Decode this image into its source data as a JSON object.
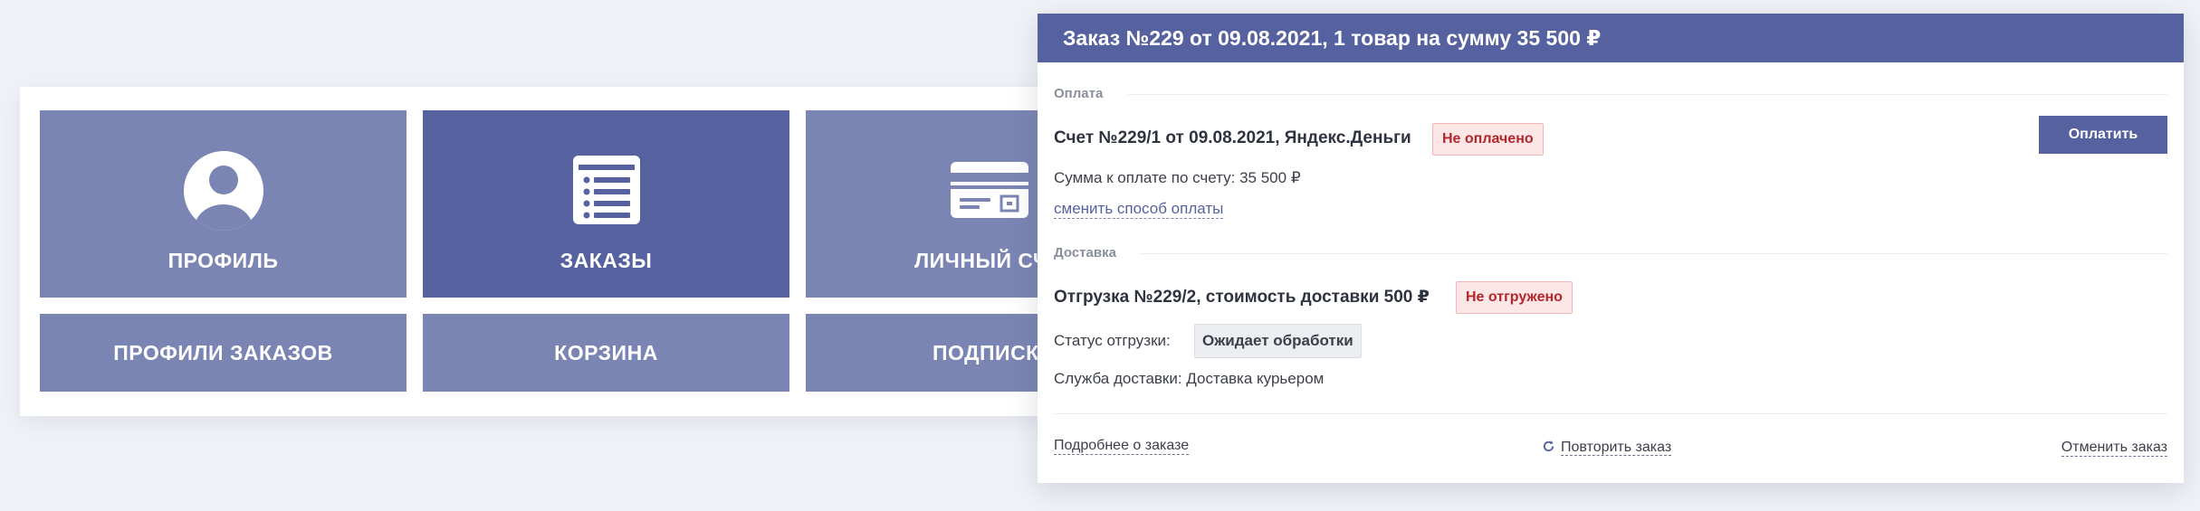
{
  "tiles": {
    "profile": {
      "label": "ПРОФИЛЬ",
      "icon": "user-icon"
    },
    "orders": {
      "label": "ЗАКАЗЫ",
      "icon": "list-icon"
    },
    "account": {
      "label": "ЛИЧНЫЙ СЧЕТ",
      "icon": "card-icon"
    },
    "order_profiles": {
      "label": "ПРОФИЛИ ЗАКАЗОВ"
    },
    "cart": {
      "label": "КОРЗИНА"
    },
    "subscriptions": {
      "label": "ПОДПИСКИ"
    }
  },
  "order": {
    "header": "Заказ №229 от 09.08.2021, 1 товар на сумму 35 500 ₽",
    "payment": {
      "section_title": "Оплата",
      "invoice": "Счет №229/1 от 09.08.2021, Яндекс.Деньги",
      "status": "Не оплачено",
      "pay_button": "Оплатить",
      "amount": "Сумма к оплате по счету: 35 500 ₽",
      "change_method": "сменить способ оплаты"
    },
    "delivery": {
      "section_title": "Доставка",
      "shipment": "Отгрузка №229/2, стоимость доставки 500 ₽",
      "status": "Не отгружено",
      "shipment_status_label": "Статус отгрузки:",
      "shipment_status_value": "Ожидает обработки",
      "service": "Служба доставки: Доставка курьером"
    },
    "footer": {
      "details": "Подробнее о заказе",
      "repeat": "Повторить заказ",
      "cancel": "Отменить заказ"
    }
  },
  "colors": {
    "accent": "#5661a0",
    "tile": "#7a85b3",
    "danger": "#b3272c"
  }
}
